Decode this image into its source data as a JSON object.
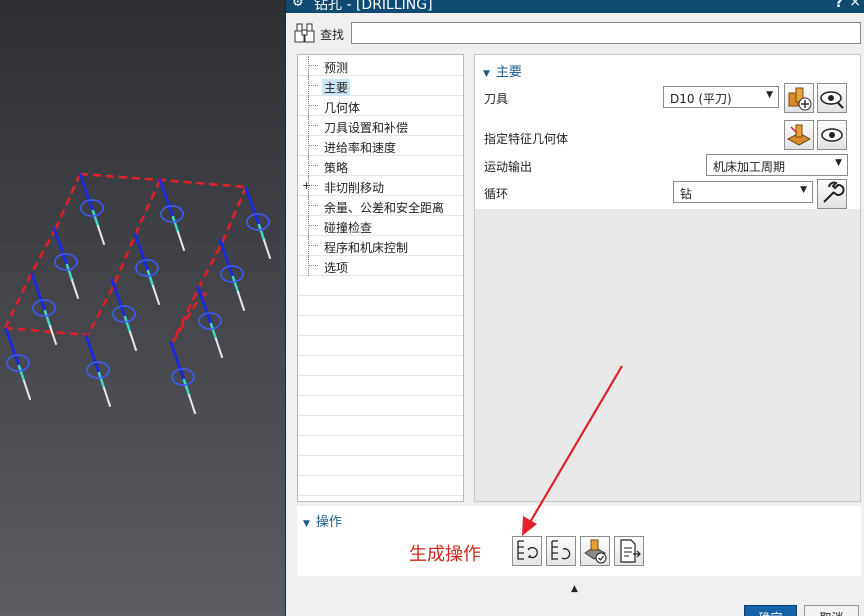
{
  "dialog": {
    "title": "钻孔 - [DRILLING]",
    "help_icon": "question-mark",
    "close_icon": "close-x"
  },
  "find": {
    "label": "查找",
    "value": ""
  },
  "nav": {
    "items": [
      {
        "label": "预测",
        "expandable": false,
        "selected": false
      },
      {
        "label": "主要",
        "expandable": false,
        "selected": true
      },
      {
        "label": "几何体",
        "expandable": false,
        "selected": false
      },
      {
        "label": "刀具设置和补偿",
        "expandable": false,
        "selected": false
      },
      {
        "label": "进给率和速度",
        "expandable": false,
        "selected": false
      },
      {
        "label": "策略",
        "expandable": false,
        "selected": false
      },
      {
        "label": "非切削移动",
        "expandable": true,
        "selected": false
      },
      {
        "label": "余量、公差和安全距离",
        "expandable": false,
        "selected": false
      },
      {
        "label": "碰撞检查",
        "expandable": false,
        "selected": false
      },
      {
        "label": "程序和机床控制",
        "expandable": false,
        "selected": false
      },
      {
        "label": "选项",
        "expandable": false,
        "selected": false
      }
    ]
  },
  "main": {
    "section_title": "主要",
    "tool_label": "刀具",
    "tool_value": "D10 (平刀)",
    "feature_geometry_label": "指定特征几何体",
    "motion_output_label": "运动输出",
    "motion_output_value": "机床加工周期",
    "cycle_label": "循环",
    "cycle_value": "钻"
  },
  "operations": {
    "section_title": "操作",
    "annotation": "生成操作"
  },
  "footer": {
    "ok_label": "确定",
    "cancel_label": "取消"
  },
  "colors": {
    "titlebar": "#0f4a72",
    "section_header": "#1a5d8f",
    "annotation": "#d0281c",
    "selection": "#cde6f5",
    "ok_button": "#1562a8"
  }
}
